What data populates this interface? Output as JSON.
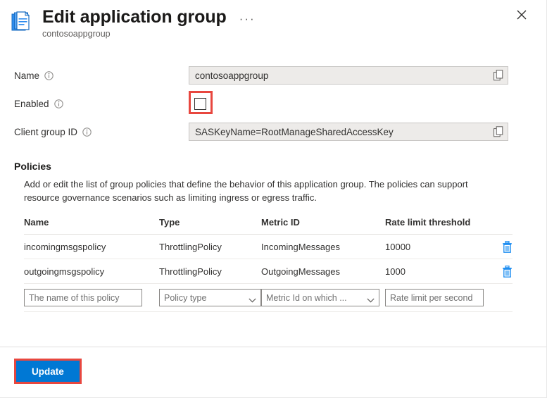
{
  "header": {
    "icon": "application-group-icon",
    "title": "Edit application group",
    "subtitle": "contosoappgroup",
    "more_label": "···",
    "close_label": "✕"
  },
  "form": {
    "name": {
      "label": "Name",
      "value": "contosoappgroup",
      "info_icon": "info-icon",
      "copy_icon": "copy-icon"
    },
    "enabled": {
      "label": "Enabled",
      "checked": false,
      "info_icon": "info-icon",
      "highlight_color": "#e8473f"
    },
    "client_group_id": {
      "label": "Client group ID",
      "value": "SASKeyName=RootManageSharedAccessKey",
      "info_icon": "info-icon",
      "copy_icon": "copy-icon"
    }
  },
  "policies": {
    "title": "Policies",
    "description": "Add or edit the list of group policies that define the behavior of this application group. The policies can support resource governance scenarios such as limiting ingress or egress traffic.",
    "columns": [
      "Name",
      "Type",
      "Metric ID",
      "Rate limit threshold"
    ],
    "rows": [
      {
        "name": "incomingmsgspolicy",
        "type": "ThrottlingPolicy",
        "metric_id": "IncomingMessages",
        "rate_limit": "10000",
        "delete_icon": "trash-icon"
      },
      {
        "name": "outgoingmsgspolicy",
        "type": "ThrottlingPolicy",
        "metric_id": "OutgoingMessages",
        "rate_limit": "1000",
        "delete_icon": "trash-icon"
      }
    ],
    "new_row": {
      "name_placeholder": "The name of this policy",
      "type_placeholder": "Policy type",
      "metric_placeholder": "Metric Id on which ...",
      "rate_placeholder": "Rate limit per second",
      "chevron_icon": "chevron-down-icon"
    }
  },
  "footer": {
    "update_label": "Update",
    "update_color": "#0078d4",
    "highlight_color": "#e8473f"
  }
}
